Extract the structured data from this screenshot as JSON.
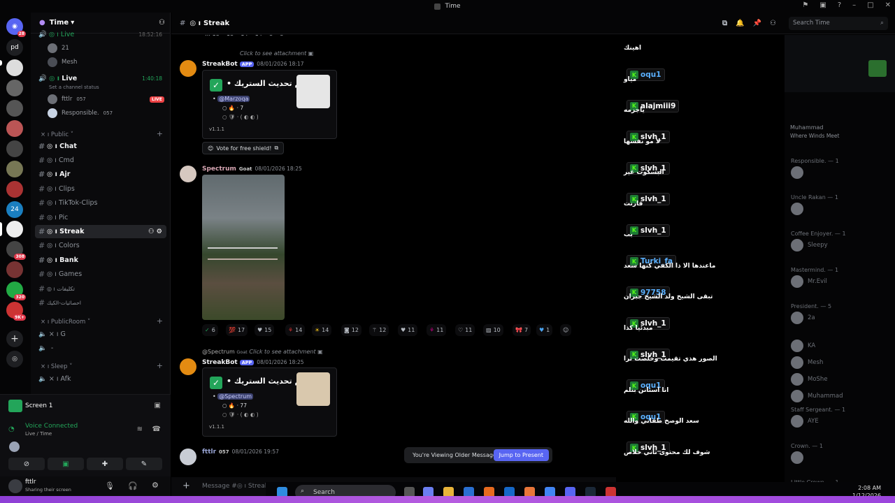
{
  "window": {
    "title": "Time"
  },
  "server": {
    "name": "Time"
  },
  "rail": {
    "home_badge": "28",
    "pd": "pd",
    "badges": [
      "24",
      "308",
      "320",
      "9K+"
    ]
  },
  "sidebar": {
    "live1": {
      "label": "Live",
      "time": "18:52:16"
    },
    "live1_users": [
      "21",
      "Mesh"
    ],
    "live2": {
      "label": "Live",
      "time": "1:40:18",
      "status": "Set a channel status",
      "live_tag": "LIVE"
    },
    "live2_users": [
      "fttlr",
      "Responsible."
    ],
    "badge_057": "057",
    "cat_public": "Public",
    "channels": [
      "Chat",
      "Cmd",
      "Ajr",
      "Clips",
      "TikTok-Clips",
      "Pic",
      "Streak",
      "Colors",
      "Bank",
      "Games",
      "تكليفات",
      "احصائيات-الكيك"
    ],
    "cat_public_room": "PublicRoom",
    "voice_channels": [
      "G",
      "-"
    ],
    "cat_sleep": "Sleep",
    "sleep_channel": "Afk"
  },
  "voice_panel": {
    "screen_title": "Screen 1",
    "status": "Voice Connected",
    "location": "Live / Time"
  },
  "user": {
    "name": "fttlr",
    "status": "Sharing their screen"
  },
  "channel": {
    "name": "Streak"
  },
  "search": {
    "placeholder": "Search Time"
  },
  "chat": {
    "attach_hint": "Click to see attachment",
    "msg1": {
      "author": "StreakBot",
      "app": "APP",
      "time": "08/01/2026 18:17",
      "title": "تم تحديث الستريك •",
      "mention": "@Marzoqa",
      "count": "7",
      "version": "v1.1.1"
    },
    "shield_button": "Vote for free shield!",
    "msg2": {
      "author": "Spectrum",
      "tag": "Goat",
      "time": "08/01/2026 18:25"
    },
    "reactions": [
      "6",
      "17",
      "15",
      "14",
      "14",
      "12",
      "12",
      "11",
      "11",
      "11",
      "10",
      "7",
      "1"
    ],
    "reply": {
      "author": "@Spectrum",
      "tag": "Goat",
      "hint": "Click to see attachment"
    },
    "msg3": {
      "author": "StreakBot",
      "app": "APP",
      "time": "08/01/2026 18:25",
      "title": "تم تحديث الستريك •",
      "mention": "@Spectrum",
      "count": "77",
      "version": "v1.1.1"
    },
    "msg4": {
      "author": "fttlr",
      "badge": "057",
      "time": "08/01/2026 19:57"
    }
  },
  "older_bar": {
    "text": "You're Viewing Older Messages",
    "button": "Jump to Present"
  },
  "composer": {
    "placeholder": "Message #◎ ı Streak"
  },
  "overlay": {
    "items": [
      {
        "name": "",
        "text": "اهينك"
      },
      {
        "name": "oqu1",
        "text": "مياو"
      },
      {
        "name": "alajmiii9",
        "text": "ياجزمه"
      },
      {
        "name": "slvh_1",
        "text": "لا مو نفسها"
      },
      {
        "name": "slvh_1",
        "text": "البسكوت غير"
      },
      {
        "name": "slvh_1",
        "text": "قارنت"
      },
      {
        "name": "slvh_1",
        "text": "بب"
      },
      {
        "name": "Turki_fa",
        "text": "ماعندها الا ذا الكفي كنها سعد"
      },
      {
        "name": "97758",
        "text": "تبقى الشيخ ولد الشيخ جبران"
      },
      {
        "name": "slvh_1",
        "text": "مبدئيا كذا"
      },
      {
        "name": "slvh_1",
        "text": "الصور هذي تقيمت وخلصت ترا"
      },
      {
        "name": "oqu1",
        "text": "انا استانن بنلم"
      },
      {
        "name": "oqu1",
        "text": "سعد الوصخ طفاني والله"
      },
      {
        "name": "slvh_1",
        "text": "شوف لك محتوى ثاني خلاص"
      }
    ]
  },
  "members": {
    "activity_user": "Muhammad",
    "activity_game": "Where Winds Meet",
    "groups": [
      {
        "cat": "Responsible. — 1",
        "name": ""
      },
      {
        "cat": "Uncle Rakan — 1",
        "name": ""
      },
      {
        "cat": "Coffee Enjoyer. — 1",
        "name": "Sleepy"
      },
      {
        "cat": "Mastermind. — 1",
        "name": "Mr.Evil"
      },
      {
        "cat": "President. — 5",
        "name": "2a"
      },
      {
        "cat": "",
        "name": "KA"
      },
      {
        "cat": "",
        "name": "Mesh"
      },
      {
        "cat": "",
        "name": "MoShe"
      },
      {
        "cat": "",
        "name": "Muhammad"
      },
      {
        "cat": "Staff Sergeant. — 1",
        "name": "AYE"
      },
      {
        "cat": "Crown. — 1",
        "name": ""
      },
      {
        "cat": "Little Crown. — 1",
        "name": ""
      }
    ]
  },
  "taskbar": {
    "search": "Search",
    "time": "2:08 AM",
    "date": "1/12/2026"
  },
  "colors": {
    "accent": "#5865f2",
    "live": "#ed4245",
    "kick_green": "#53fc18",
    "connected": "#23a55a"
  }
}
